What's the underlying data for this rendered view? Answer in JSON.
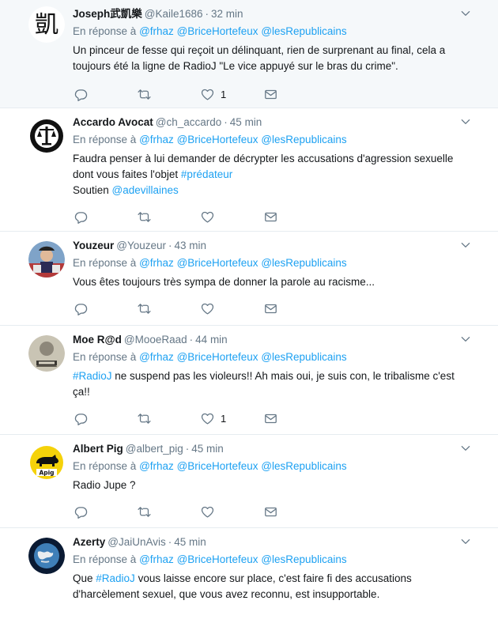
{
  "tweets": [
    {
      "fullname": "Joseph武凱樂",
      "username": "@Kaile1686",
      "time": "32 min",
      "reply_prefix": "En réponse à",
      "reply_mentions": [
        "@frhaz",
        "@BriceHortefeux",
        "@lesRepublicains"
      ],
      "line1": "Un pinceur de fesse qui reçoit un délinquant, rien de surprenant au final, cela a",
      "line2": "toujours été la ligne de RadioJ \"Le vice appuyé sur le bras du crime\".",
      "avatar_glyph": "凱",
      "like_count": "1"
    },
    {
      "fullname": "Accardo Avocat",
      "username": "@ch_accardo",
      "time": "45 min",
      "reply_prefix": "En réponse à",
      "reply_mentions": [
        "@frhaz",
        "@BriceHortefeux",
        "@lesRepublicains"
      ],
      "line1": "Faudra penser à lui demander de décrypter les accusations d'agression sexuelle",
      "line2_text": "dont vous faites l'objet ",
      "line2_hashtag": "#prédateur",
      "line3_text": "Soutien ",
      "line3_mention": "@adevillaines"
    },
    {
      "fullname": "Youzeur",
      "username": "@Youzeur",
      "time": "43 min",
      "reply_prefix": "En réponse à",
      "reply_mentions": [
        "@frhaz",
        "@BriceHortefeux",
        "@lesRepublicains"
      ],
      "line1": "Vous êtes toujours très sympa de donner la parole au racisme..."
    },
    {
      "fullname": "Moe R@d",
      "username": "@MooeRaad",
      "time": "44 min",
      "reply_prefix": "En réponse à",
      "reply_mentions": [
        "@frhaz",
        "@BriceHortefeux",
        "@lesRepublicains"
      ],
      "line1_hashtag": "#RadioJ",
      "line1_text": " ne suspend pas les violeurs!! Ah mais oui, je suis con, le tribalisme c'est",
      "line2": "ça!!",
      "like_count": "1"
    },
    {
      "fullname": "Albert Pig",
      "username": "@albert_pig",
      "time": "45 min",
      "reply_prefix": "En réponse à",
      "reply_mentions": [
        "@frhaz",
        "@BriceHortefeux",
        "@lesRepublicains"
      ],
      "line1": "Radio Jupe ?",
      "avatar_label": "Apig"
    },
    {
      "fullname": "Azerty",
      "username": "@JaiUnAvis",
      "time": "45 min",
      "reply_prefix": "En réponse à",
      "reply_mentions": [
        "@frhaz",
        "@BriceHortefeux",
        "@lesRepublicains"
      ],
      "line1_text": "Que ",
      "line1_hashtag": "#RadioJ",
      "line1_rest": " vous laisse encore sur place, c'est faire fi des accusations",
      "line2": "d'harcèlement sexuel, que vous avez reconnu, est insupportable."
    }
  ],
  "colors": {
    "link": "#1da1f2",
    "muted": "#657786",
    "text": "#14171a",
    "border": "#e6ecf0",
    "highlight_bg": "#f5f8fa"
  },
  "icons": [
    "reply-icon",
    "retweet-icon",
    "like-icon",
    "direct-message-icon",
    "caret-down-icon"
  ]
}
